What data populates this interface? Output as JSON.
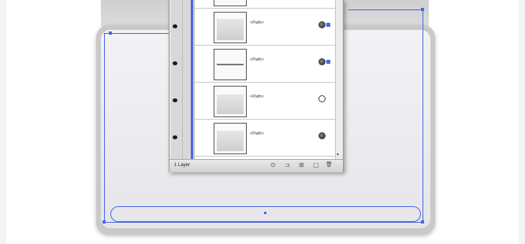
{
  "layers_panel": {
    "rows": [
      {
        "label": "<Path>",
        "target": "filled",
        "selected": true,
        "thumb": "shape"
      },
      {
        "label": "<Path>",
        "target": "filled",
        "selected": true,
        "thumb": "line"
      },
      {
        "label": "<Path>",
        "target": "hollow",
        "selected": false,
        "thumb": "shape"
      },
      {
        "label": "<Path>",
        "target": "filled",
        "selected": false,
        "thumb": "shape"
      }
    ],
    "status_text": "1 Layer",
    "buttons": {
      "locate": "⊙",
      "make_clipping": "⊐",
      "new_sublayer": "⊞",
      "new_layer": "▢",
      "delete": "🗑"
    }
  },
  "colors": {
    "selection": "#4a67e0",
    "panel_bg": "#e4e4e4"
  }
}
